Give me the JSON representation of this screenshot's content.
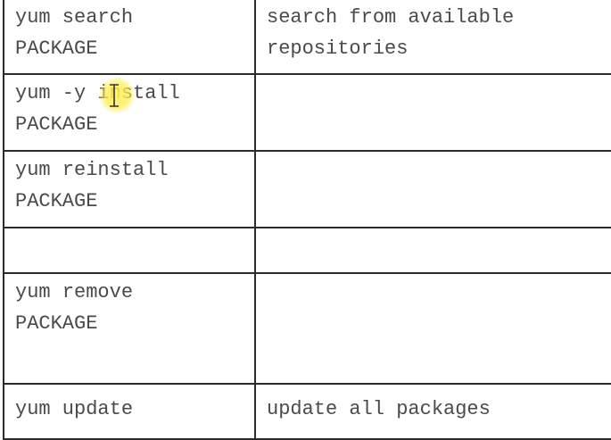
{
  "rows": [
    {
      "command": "yum search\nPACKAGE",
      "description": "search from available\nrepositories"
    },
    {
      "command": "yum -y install\nPACKAGE",
      "description": ""
    },
    {
      "command": "yum reinstall\nPACKAGE",
      "description": ""
    },
    {
      "command": "",
      "description": ""
    },
    {
      "command": "yum remove\nPACKAGE",
      "description": ""
    },
    {
      "command": "yum update",
      "description": "update all packages"
    }
  ],
  "icons": {
    "cursor": "text-cursor-icon",
    "cursor_highlight_color": "#fff05a"
  },
  "colors": {
    "text": "#4a4a4a",
    "border": "#2b2b2b"
  }
}
